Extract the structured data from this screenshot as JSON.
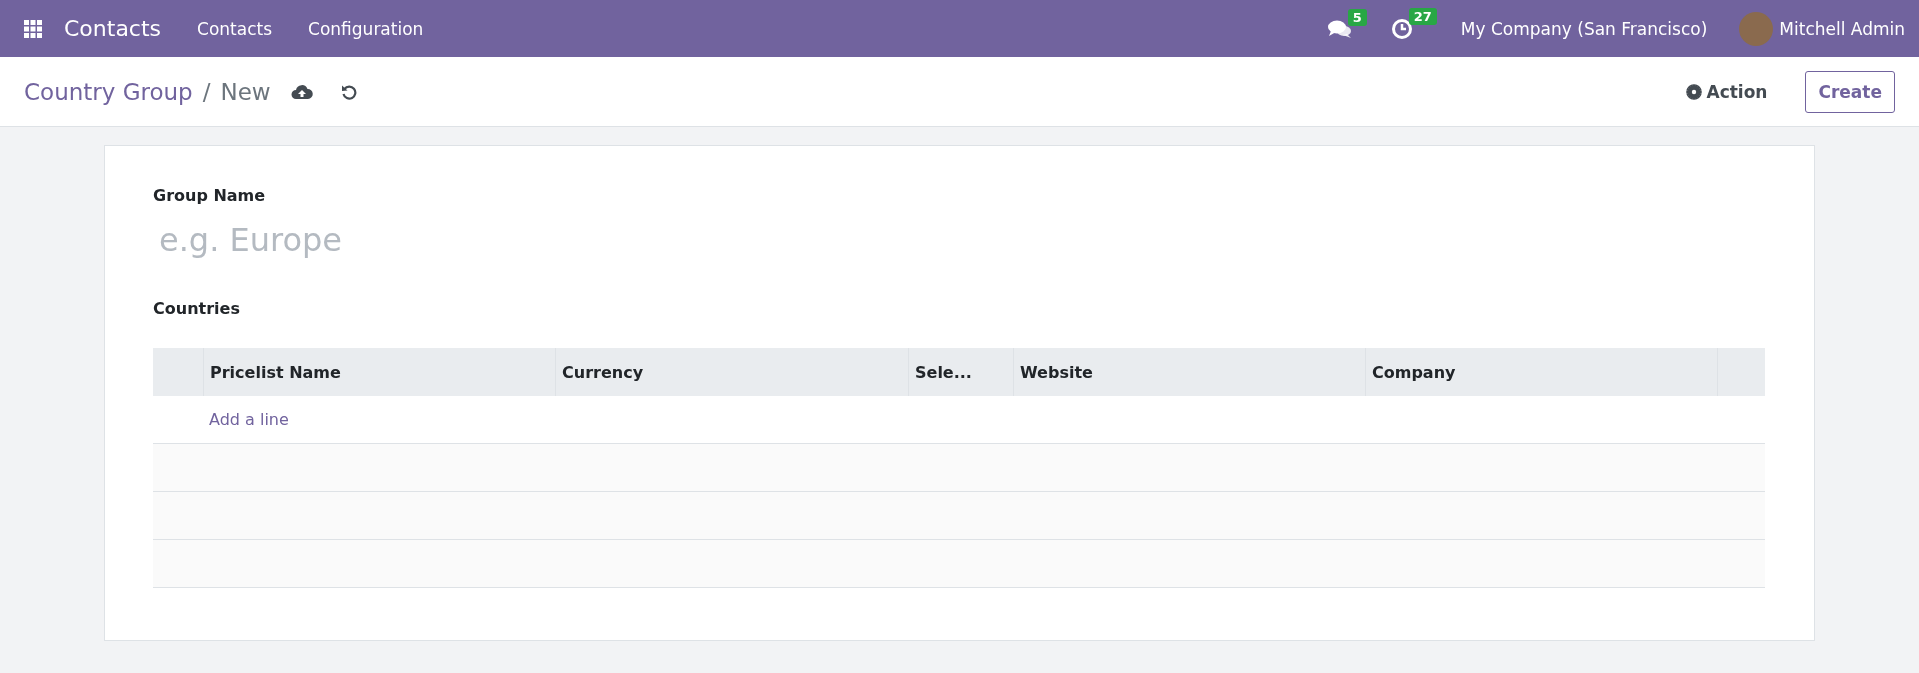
{
  "navbar": {
    "app_name": "Contacts",
    "menu": [
      "Contacts",
      "Configuration"
    ],
    "messages_count": "5",
    "activities_count": "27",
    "company": "My Company (San Francisco)",
    "user": "Mitchell Admin"
  },
  "breadcrumb": {
    "parent": "Country Group",
    "separator": "/",
    "current": "New"
  },
  "actions": {
    "action": "Action",
    "create": "Create"
  },
  "form": {
    "name_label": "Group Name",
    "name_placeholder": "e.g. Europe",
    "countries_label": "Countries",
    "table": {
      "columns": [
        "Pricelist Name",
        "Currency",
        "Sele...",
        "Website",
        "Company"
      ],
      "add_line": "Add a line"
    }
  }
}
